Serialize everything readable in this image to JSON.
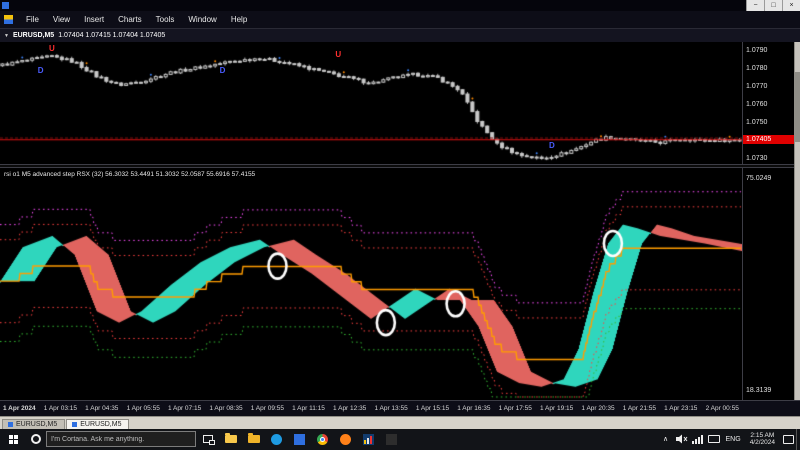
{
  "window": {
    "controls": [
      {
        "name": "minimize-button",
        "glyph": "−"
      },
      {
        "name": "maximize-button",
        "glyph": "□"
      },
      {
        "name": "close-button",
        "glyph": "×"
      }
    ]
  },
  "menu_bar": {
    "items": [
      "File",
      "View",
      "Insert",
      "Charts",
      "Tools",
      "Window",
      "Help"
    ]
  },
  "chart_header": {
    "collapse_glyph": "▼",
    "symbol": "EURUSD,M5",
    "ohlc": "1.07404 1.07415 1.07404 1.07405"
  },
  "time_axis": {
    "labels": [
      "1 Apr 2024",
      "1 Apr 03:15",
      "1 Apr 04:35",
      "1 Apr 05:55",
      "1 Apr 07:15",
      "1 Apr 08:35",
      "1 Apr 09:55",
      "1 Apr 11:15",
      "1 Apr 12:35",
      "1 Apr 13:55",
      "1 Apr 15:15",
      "1 Apr 16:35",
      "1 Apr 17:55",
      "1 Apr 19:15",
      "1 Apr 20:35",
      "1 Apr 21:55",
      "1 Apr 23:15",
      "2 Apr 00:55"
    ]
  },
  "tabs": [
    {
      "label": "EURUSD,M5",
      "active": false
    },
    {
      "label": "EURUSD,M5",
      "active": true
    }
  ],
  "taskbar": {
    "search_placeholder": "I'm Cortana. Ask me anything.",
    "icons": [
      {
        "name": "file-explorer-icon",
        "glyph": "folder",
        "color": "#f7c84b"
      },
      {
        "name": "documents-folder-icon",
        "glyph": "folder",
        "color": "#f0b429"
      },
      {
        "name": "edge-icon",
        "glyph": "disc",
        "color": "#1e9be2"
      },
      {
        "name": "store-icon",
        "glyph": "tile",
        "color": "#2f6fe0"
      },
      {
        "name": "chrome-icon",
        "glyph": "chrome",
        "color": "#4285f4"
      },
      {
        "name": "firefox-icon",
        "glyph": "disc",
        "color": "#ff8119"
      },
      {
        "name": "metatrader-icon",
        "glyph": "chart",
        "color": "#123c6e"
      },
      {
        "name": "terminal-icon",
        "glyph": "tile",
        "color": "#2d2d2d"
      }
    ],
    "tray": {
      "language": "ENG",
      "time": "2:15 AM",
      "date": "4/2/2024"
    }
  },
  "chart_data": [
    {
      "type": "candlestick",
      "title": "EURUSD,M5",
      "ohlc_display": "1.07404 1.07415 1.07404 1.07405",
      "y_axis": {
        "min": 1.0727,
        "max": 1.0795,
        "ticks": [
          {
            "label": "1.0790",
            "value": 1.079
          },
          {
            "label": "1.0780",
            "value": 1.078
          },
          {
            "label": "1.0770",
            "value": 1.077
          },
          {
            "label": "1.0760",
            "value": 1.076
          },
          {
            "label": "1.0750",
            "value": 1.075
          },
          {
            "label": "1.0740",
            "value": 1.074
          },
          {
            "label": "1.0730",
            "value": 1.073
          }
        ]
      },
      "current_price": {
        "label": "1.07405",
        "value": 1.07405
      },
      "ask_line_value": 1.07415,
      "num_candles": 150,
      "path": [
        [
          0.0,
          1.0782
        ],
        [
          0.04,
          1.0785
        ],
        [
          0.07,
          1.0787
        ],
        [
          0.1,
          1.0784
        ],
        [
          0.13,
          1.0776
        ],
        [
          0.16,
          1.0771
        ],
        [
          0.19,
          1.0773
        ],
        [
          0.23,
          1.0778
        ],
        [
          0.27,
          1.0781
        ],
        [
          0.31,
          1.0784
        ],
        [
          0.35,
          1.0786
        ],
        [
          0.38,
          1.0784
        ],
        [
          0.42,
          1.078
        ],
        [
          0.46,
          1.0776
        ],
        [
          0.5,
          1.0772
        ],
        [
          0.53,
          1.0775
        ],
        [
          0.56,
          1.0777
        ],
        [
          0.59,
          1.0775
        ],
        [
          0.62,
          1.0768
        ],
        [
          0.645,
          1.075
        ],
        [
          0.67,
          1.0738
        ],
        [
          0.7,
          1.0732
        ],
        [
          0.73,
          1.073
        ],
        [
          0.76,
          1.0733
        ],
        [
          0.78,
          1.0736
        ],
        [
          0.8,
          1.074
        ],
        [
          0.82,
          1.0742
        ],
        [
          0.84,
          1.0741
        ],
        [
          0.86,
          1.074
        ],
        [
          0.89,
          1.0739
        ],
        [
          0.92,
          1.0741
        ],
        [
          0.95,
          1.074
        ],
        [
          1.0,
          1.07405
        ]
      ],
      "markers": [
        {
          "type": "U",
          "x": 0.07,
          "value": 1.0791,
          "color": "#ff2f2f"
        },
        {
          "type": "D",
          "x": 0.055,
          "value": 1.0779,
          "color": "#4a5cff"
        },
        {
          "type": "D",
          "x": 0.3,
          "value": 1.0779,
          "color": "#4a5cff"
        },
        {
          "type": "U",
          "x": 0.456,
          "value": 1.0788,
          "color": "#ff2f2f"
        },
        {
          "type": "D",
          "x": 0.744,
          "value": 1.0737,
          "color": "#4a5cff"
        }
      ]
    },
    {
      "type": "line",
      "title": "rsi o1 M5 advanced step RSX (32)",
      "values_text": "56.3032 53.4491 51.3032 52.0587 55.6916 57.4155",
      "y_axis": {
        "min": 16.5,
        "max": 78,
        "top_label": "75.0249",
        "top_value": 75.0249,
        "bottom_label": "18.3139",
        "bottom_value": 18.3139
      },
      "x": [
        0.0,
        0.03,
        0.07,
        0.1,
        0.13,
        0.16,
        0.19,
        0.23,
        0.27,
        0.31,
        0.35,
        0.38,
        0.42,
        0.46,
        0.5,
        0.53,
        0.56,
        0.59,
        0.62,
        0.645,
        0.67,
        0.7,
        0.73,
        0.76,
        0.78,
        0.8,
        0.82,
        0.84,
        0.86,
        0.89,
        0.92,
        0.95,
        1.0
      ],
      "fast": [
        48,
        57,
        60,
        55,
        40,
        37,
        40,
        47,
        53,
        57,
        59,
        55,
        50,
        44,
        38,
        42,
        46,
        43,
        43,
        36,
        24,
        21,
        20,
        22,
        30,
        45,
        58,
        63,
        62,
        60,
        59,
        58,
        56
      ],
      "circles": [
        {
          "x": 0.374,
          "value": 52
        },
        {
          "x": 0.52,
          "value": 37
        },
        {
          "x": 0.614,
          "value": 42
        },
        {
          "x": 0.826,
          "value": 58
        }
      ],
      "colors": {
        "up_fill": "#2fd6bd",
        "down_fill": "#e0645f",
        "step_line": "#ff9c00",
        "band_red": "#ff4040",
        "band_magenta": "#ff4dff",
        "band_green": "#33bb33",
        "circle": "#ffffff"
      }
    }
  ]
}
